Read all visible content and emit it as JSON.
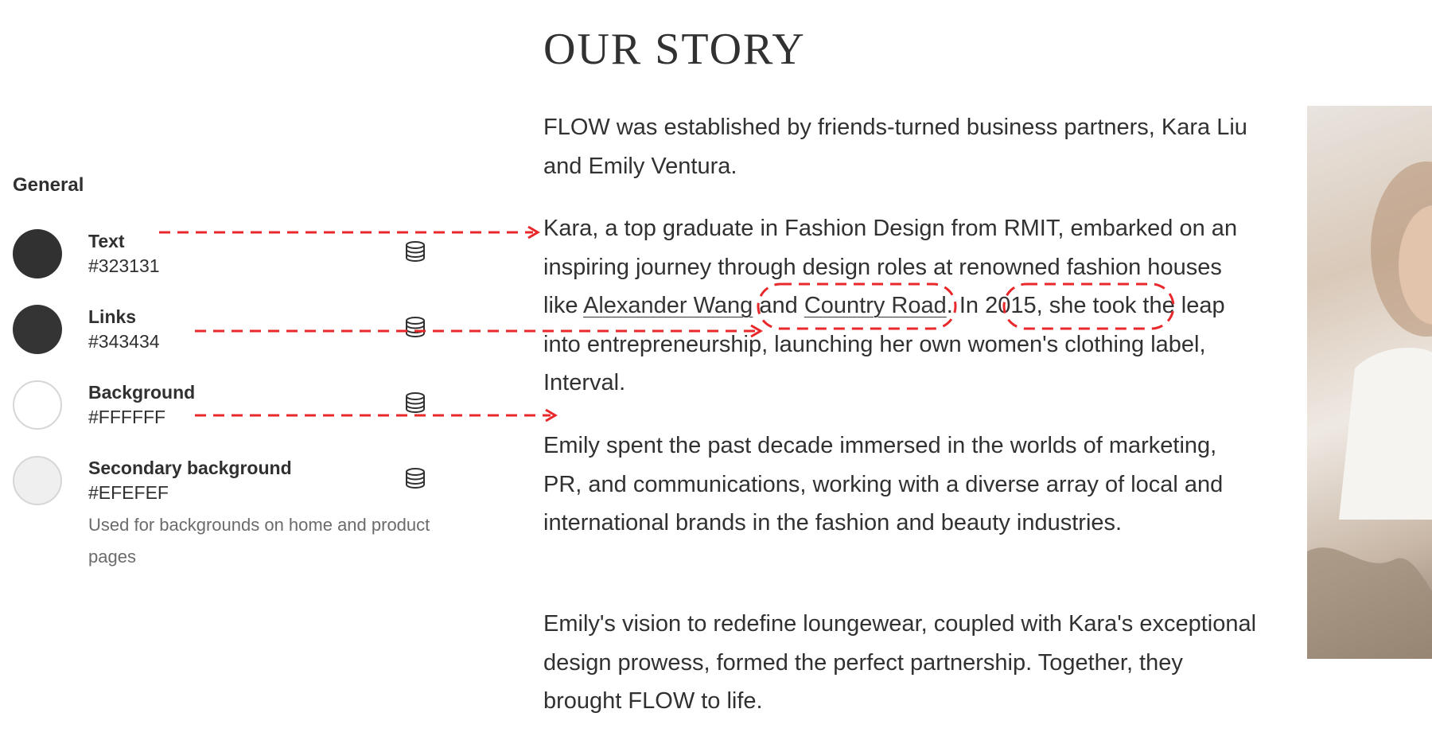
{
  "settings": {
    "section_title": "General",
    "colors": [
      {
        "label": "Text",
        "value": "#323131",
        "swatch": "#323131"
      },
      {
        "label": "Links",
        "value": "#343434",
        "swatch": "#343434"
      },
      {
        "label": "Background",
        "value": "#FFFFFF",
        "swatch": "#FFFFFF"
      },
      {
        "label": "Secondary background",
        "value": "#EFEFEF",
        "swatch": "#EFEFEF"
      }
    ],
    "secondary_help": "Used for backgrounds on home and product pages",
    "icon": "database-icon"
  },
  "story": {
    "title": "OUR STORY",
    "p1": "FLOW was established by friends-turned business partners, Kara Liu and Emily Ventura.",
    "p2_a": "Kara, a top graduate in Fashion Design from RMIT, embarked on an inspiring journey through design roles at renowned fashion houses like ",
    "p2_link1": "Alexander Wang",
    "p2_b": " and ",
    "p2_link2": "Country Road",
    "p2_c": ". In 2015, she took the leap into entrepreneurship, launching her own women's clothing label, Interval.",
    "p3": "Emily spent the past decade immersed in the worlds of marketing, PR, and communications, working with a diverse array of local and international brands in the fashion and beauty industries.",
    "p4": "Emily's vision to redefine loungewear, coupled with Kara's exceptional design prowess, formed the perfect partnership. Together, they brought FLOW to life."
  },
  "annotation_color": "#e8282b"
}
